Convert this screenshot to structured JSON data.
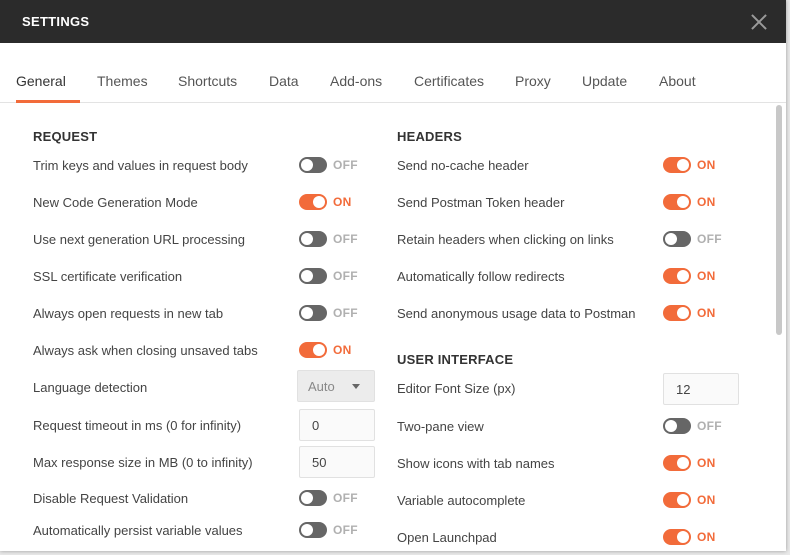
{
  "window": {
    "title": "SETTINGS"
  },
  "tabs": [
    {
      "label": "General",
      "active": true
    },
    {
      "label": "Themes"
    },
    {
      "label": "Shortcuts"
    },
    {
      "label": "Data"
    },
    {
      "label": "Add-ons"
    },
    {
      "label": "Certificates"
    },
    {
      "label": "Proxy"
    },
    {
      "label": "Update"
    },
    {
      "label": "About"
    }
  ],
  "request": {
    "title": "REQUEST",
    "rows": [
      {
        "label": "Trim keys and values in request body",
        "state": "OFF"
      },
      {
        "label": "New Code Generation Mode",
        "state": "ON"
      },
      {
        "label": "Use next generation URL processing",
        "state": "OFF"
      },
      {
        "label": "SSL certificate verification",
        "state": "OFF"
      },
      {
        "label": "Always open requests in new tab",
        "state": "OFF"
      },
      {
        "label": "Always ask when closing unsaved tabs",
        "state": "ON"
      },
      {
        "label": "Language detection",
        "value": "Auto"
      },
      {
        "label": "Request timeout in ms (0 for infinity)",
        "value": "0"
      },
      {
        "label": "Max response size in MB (0 to infinity)",
        "value": "50"
      },
      {
        "label": "Disable Request Validation",
        "state": "OFF"
      },
      {
        "label": "Automatically persist variable values",
        "state": "OFF"
      }
    ]
  },
  "headers": {
    "title": "HEADERS",
    "rows": [
      {
        "label": "Send no-cache header",
        "state": "ON"
      },
      {
        "label": "Send Postman Token header",
        "state": "ON"
      },
      {
        "label": "Retain headers when clicking on links",
        "state": "OFF"
      },
      {
        "label": "Automatically follow redirects",
        "state": "ON"
      },
      {
        "label": "Send anonymous usage data to Postman",
        "state": "ON"
      }
    ]
  },
  "ui": {
    "title": "USER INTERFACE",
    "rows": [
      {
        "label": "Editor Font Size (px)",
        "value": "12"
      },
      {
        "label": "Two-pane view",
        "state": "OFF"
      },
      {
        "label": "Show icons with tab names",
        "state": "ON"
      },
      {
        "label": "Variable autocomplete",
        "state": "ON"
      },
      {
        "label": "Open Launchpad",
        "state": "ON"
      }
    ]
  },
  "colors": {
    "accent": "#f26b3a",
    "titlebar": "#2b2b2b",
    "toggle_off": "#666666"
  }
}
